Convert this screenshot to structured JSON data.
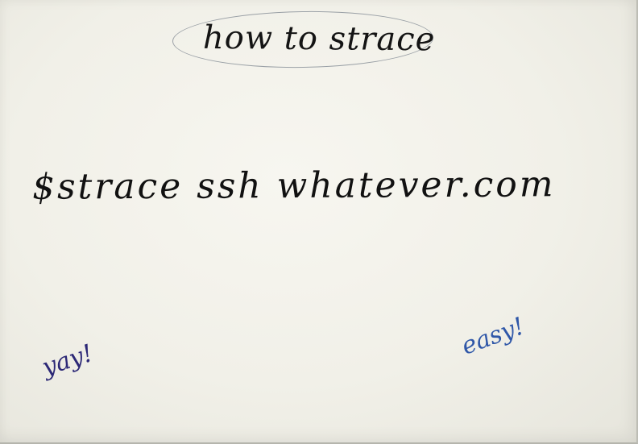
{
  "title": {
    "text": "how to strace"
  },
  "main": {
    "command": "$strace ssh whatever.com"
  },
  "notes": {
    "yay": "yay!",
    "easy": "easy!"
  },
  "colors": {
    "paper": "#f1f0e8",
    "ink_black": "#111111",
    "ink_purple": "#2c2876",
    "ink_blue": "#2f57a8",
    "bubble_outline": "#9aa0a6"
  }
}
